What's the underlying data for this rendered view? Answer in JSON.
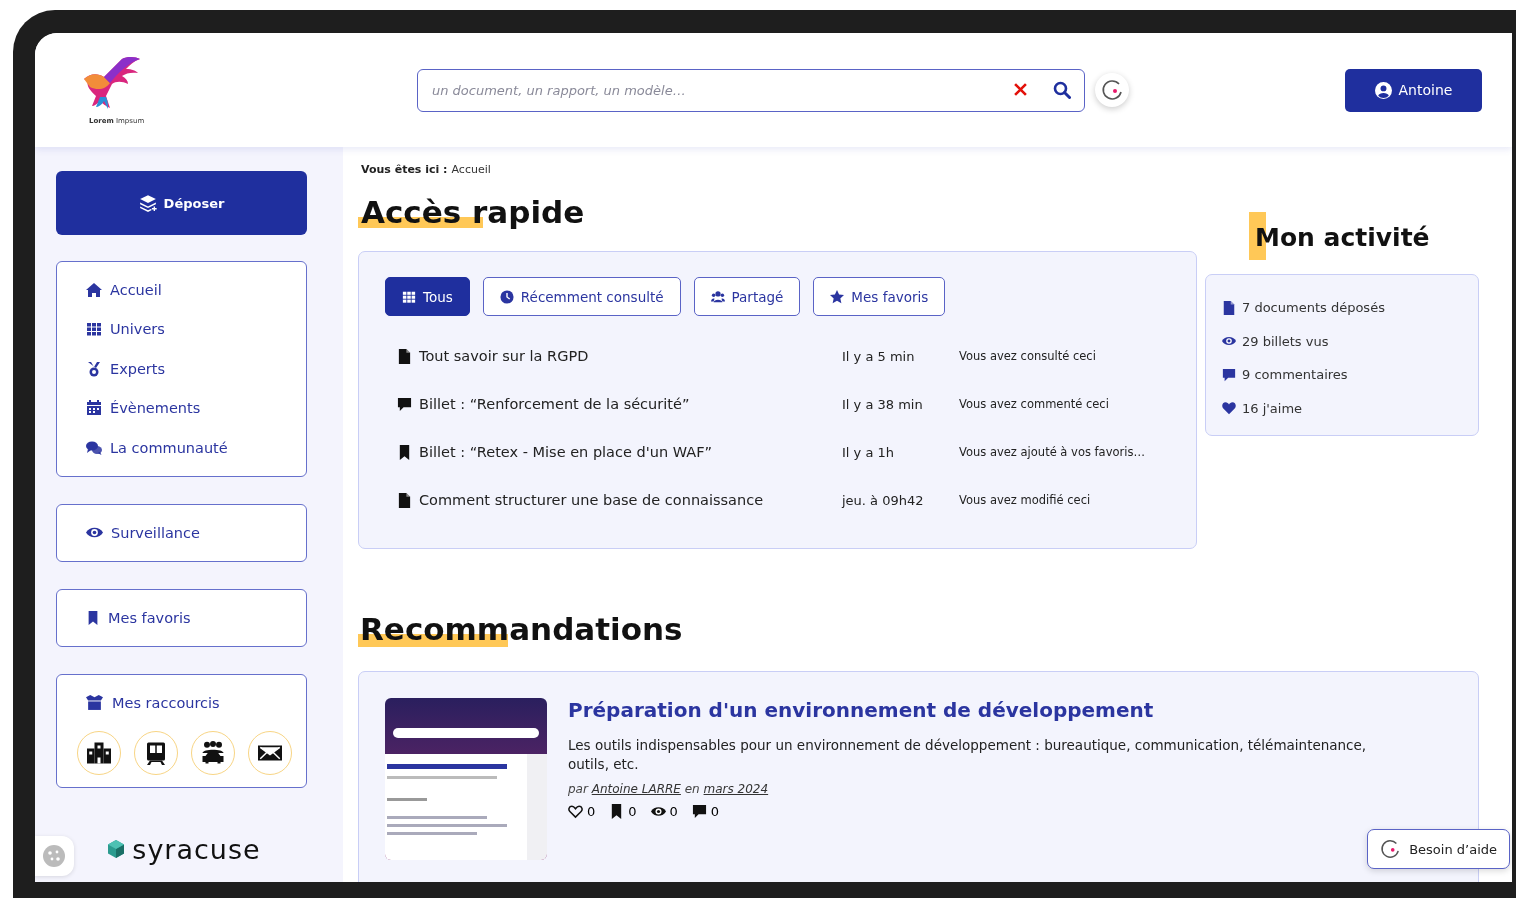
{
  "header": {
    "logo_text": "**Lorem** Impsum",
    "search": {
      "placeholder": "un document, un rapport, un modèle…"
    },
    "user_button": "Antoine"
  },
  "sidebar": {
    "deposit_button": "Déposer",
    "nav": [
      {
        "kind": "home",
        "label": "Accueil"
      },
      {
        "kind": "grid",
        "label": "Univers"
      },
      {
        "kind": "medal",
        "label": "Experts"
      },
      {
        "kind": "calendar",
        "label": "Évènements"
      },
      {
        "kind": "chat",
        "label": "La communauté"
      }
    ],
    "watch": {
      "kind": "eye",
      "label": "Surveillance"
    },
    "favorites": {
      "kind": "bookmark",
      "label": "Mes favoris"
    },
    "shortcuts": {
      "title": "Mes raccourcis",
      "items": [
        {
          "kind": "building"
        },
        {
          "kind": "train"
        },
        {
          "kind": "carpool"
        },
        {
          "kind": "mail"
        }
      ]
    },
    "brand": "syracuse"
  },
  "breadcrumb": {
    "label": "Vous êtes ici :",
    "current": "Accueil"
  },
  "quick_access": {
    "title": "Accès rapide",
    "tabs": [
      {
        "kind": "grid",
        "label": "Tous",
        "selected": true
      },
      {
        "kind": "clock",
        "label": "Récemment consulté",
        "selected": false
      },
      {
        "kind": "users",
        "label": "Partagé",
        "selected": false
      },
      {
        "kind": "star",
        "label": "Mes favoris",
        "selected": false
      }
    ],
    "rows": [
      {
        "kind": "file",
        "title": "Tout savoir sur la RGPD",
        "time": "Il y a 5 min",
        "action": "Vous avez consulté ceci"
      },
      {
        "kind": "comment",
        "title": "Billet : “Renforcement de la sécurité”",
        "time": "Il y a 38 min",
        "action": "Vous avez commenté ceci"
      },
      {
        "kind": "bookmark",
        "title": "Billet : “Retex - Mise en place d'un WAF”",
        "time": "Il y a 1h",
        "action": "Vous avez ajouté à vos favoris…"
      },
      {
        "kind": "file",
        "title": "Comment structurer une base de connaissance",
        "time": "jeu. à 09h42",
        "action": "Vous avez modifié ceci"
      }
    ]
  },
  "activity": {
    "title": "Mon activité",
    "items": [
      {
        "kind": "file",
        "text": "7 documents déposés"
      },
      {
        "kind": "eye",
        "text": "29 billets vus"
      },
      {
        "kind": "comment",
        "text": "9 commentaires"
      },
      {
        "kind": "heart",
        "text": "16 j'aime"
      }
    ]
  },
  "recommendations": {
    "title": "Recommandations",
    "cards": [
      {
        "image": {
          "kind": "picture"
        },
        "title": "Préparation d'un environnement de développement",
        "description": "Les outils indispensables pour un environnement de développement : bureautique, communication, télémaintenance, outils, etc.",
        "byline": {
          "prefix": "par",
          "author": "Antoine LARRE",
          "middle": "en",
          "date": "mars 2024"
        },
        "counts": [
          {
            "kind": "heart-outline",
            "value": "0"
          },
          {
            "kind": "bookmark",
            "value": "0"
          },
          {
            "kind": "eye",
            "value": "0"
          },
          {
            "kind": "comment",
            "value": "0"
          }
        ]
      }
    ]
  },
  "help_button": "Besoin d’aide"
}
